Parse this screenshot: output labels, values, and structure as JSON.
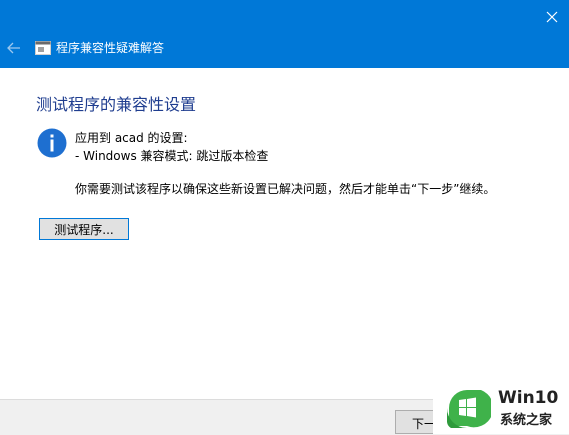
{
  "window": {
    "title": "程序兼容性疑难解答",
    "close_icon": "close-icon",
    "back_icon": "back-arrow-icon"
  },
  "content": {
    "heading": "测试程序的兼容性设置",
    "settings_applied": "应用到 acad 的设置:",
    "compat_mode": "- Windows 兼容模式: 跳过版本检查",
    "instruction": "你需要测试该程序以确保这些新设置已解决问题，然后才能单击“下一步”继续。",
    "test_button_label": "测试程序..."
  },
  "footer": {
    "next_button_label": "下一"
  },
  "watermark": {
    "line1": "Win10",
    "line2": "系统之家"
  },
  "colors": {
    "titlebar": "#0078d7",
    "heading": "#1f3d8f",
    "info_icon": "#1e6fd0",
    "logo_green": "#3fb24a"
  }
}
